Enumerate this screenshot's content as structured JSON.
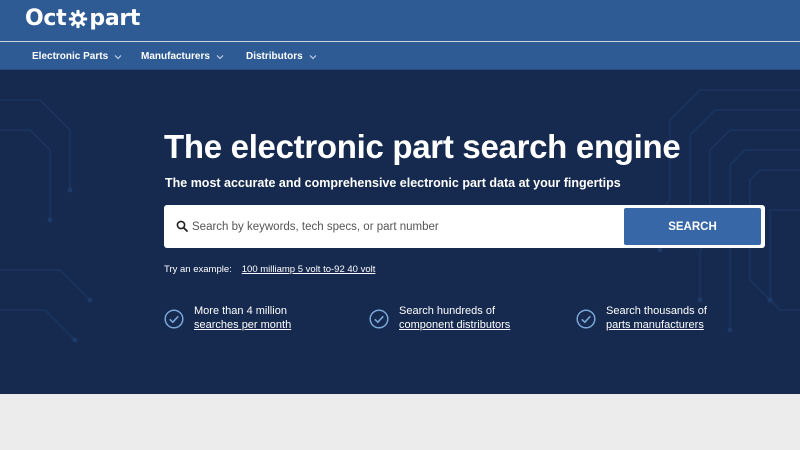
{
  "brand": {
    "logo_text_left": "Oct",
    "logo_text_right": "part"
  },
  "nav": {
    "items": [
      {
        "label": "Electronic Parts"
      },
      {
        "label": "Manufacturers"
      },
      {
        "label": "Distributors"
      }
    ]
  },
  "hero": {
    "title": "The electronic part search engine",
    "subtitle": "The most accurate and comprehensive electronic part data at your fingertips"
  },
  "search": {
    "placeholder": "Search by keywords, tech specs, or part number",
    "value": "",
    "button_label": "SEARCH"
  },
  "example": {
    "prefix": "Try an example:",
    "link": "100 milliamp 5 volt to-92 40 volt"
  },
  "features": [
    {
      "line1": "More than 4 million",
      "link": "searches per month"
    },
    {
      "line1": "Search hundreds of",
      "link": "component distributors"
    },
    {
      "line1": "Search thousands of",
      "link": "parts manufacturers"
    }
  ],
  "colors": {
    "header_bg": "#2f5b94",
    "hero_bg": "#152a4e",
    "search_button": "#3867a8",
    "check_icon": "#7aa6d8"
  }
}
